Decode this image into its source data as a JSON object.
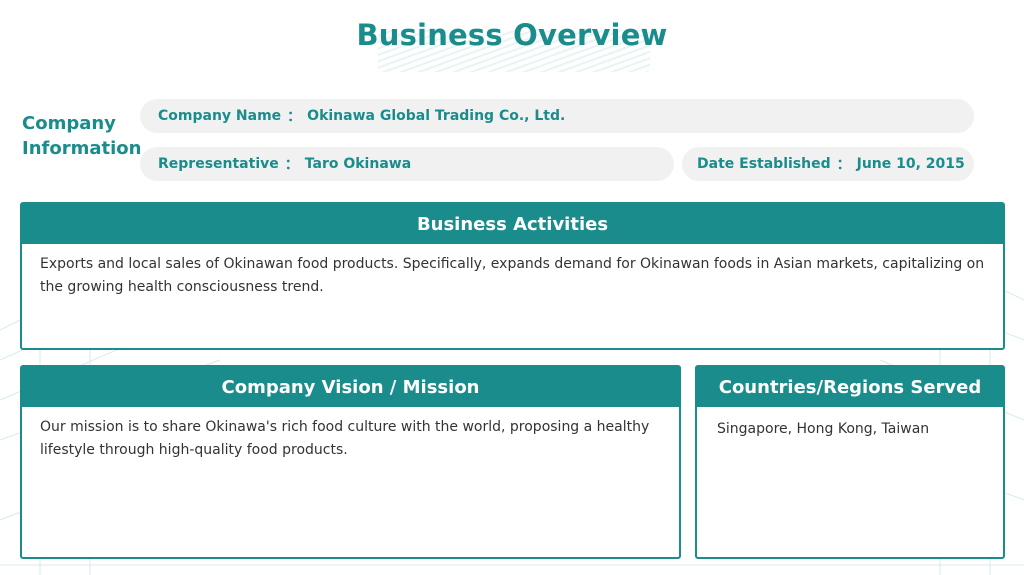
{
  "title": "Business Overview",
  "company_info": {
    "label": "Company Information",
    "name_label": "Company Name",
    "name_value": "Okinawa Global Trading Co., Ltd.",
    "rep_label": "Representative",
    "rep_value": "Taro Okinawa",
    "date_label": "Date Established",
    "date_value": "June 10, 2015",
    "separator": "："
  },
  "activities": {
    "header": "Business Activities",
    "body": "Exports and local sales of Okinawan food products. Specifically, expands demand for Okinawan foods in Asian markets, capitalizing on the growing health consciousness trend."
  },
  "vision": {
    "header": "Company Vision / Mission",
    "body": "Our mission is to share Okinawa's rich food culture with the world, proposing a healthy lifestyle through high-quality food products."
  },
  "countries": {
    "header": "Countries/Regions Served",
    "body": "Singapore, Hong Kong, Taiwan"
  },
  "colors": {
    "accent": "#1a8c8c",
    "pill_bg": "#f1f1f1",
    "text": "#333333"
  }
}
